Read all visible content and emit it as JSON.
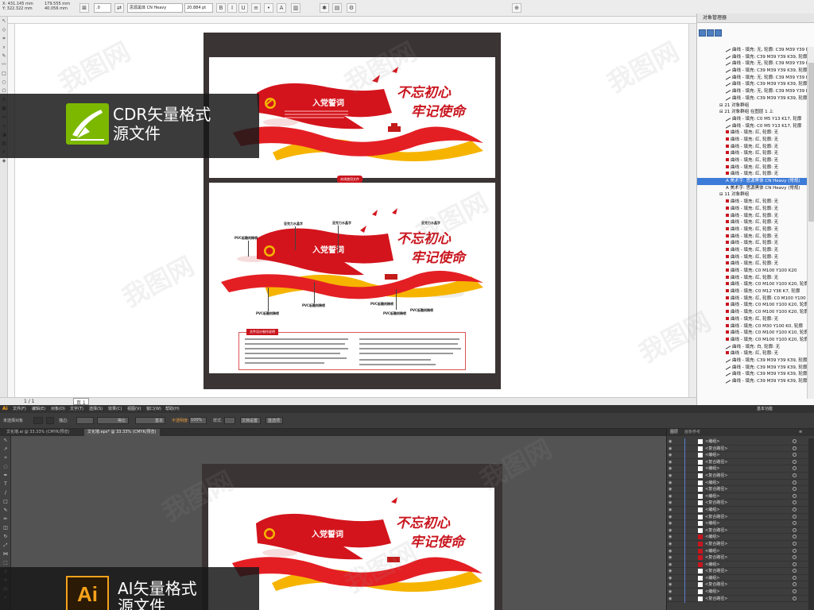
{
  "cdr": {
    "toolbar": {
      "x_label": "X:",
      "x_value": "431.145 mm",
      "y_label": "Y:",
      "y_value": "322.322 mm",
      "w_value": "179.555 mm",
      "h_value": "40.056 mm",
      "angle": ".0",
      "font_name": "思源黑体 CN Heavy",
      "font_size": "20.884 pt"
    },
    "status": {
      "page_indicator": "1 / 1",
      "page_tab": "页 1"
    },
    "separator_label": "本线使用文件",
    "artwork": {
      "flag_title": "入党誓词",
      "calligraphy_1": "不忘初心",
      "calligraphy_2": "牢记使命",
      "callouts": [
        "亚克力水晶字",
        "亚克力水晶字",
        "PVC板雕刻精喷",
        "PVC板雕刻精喷",
        "PVC板雕刻精喷",
        "PVC板雕刻精喷",
        "PVC板雕刻精喷"
      ],
      "notes_title": "文件设计制作说明"
    },
    "overlay_text_line1": "CDR矢量格式",
    "overlay_text_line2": "源文件"
  },
  "object_manager": {
    "title": "对象管理器",
    "rows": [
      {
        "text": "曲线 - 填充: 无, 轮廓: C39 M39 Y39 K39",
        "type": "curve"
      },
      {
        "text": "曲线 - 填充: C39 M39 Y39 K39, 轮廓",
        "type": "curve"
      },
      {
        "text": "曲线 - 填充: 无, 轮廓: C39 M39 Y39 K39",
        "type": "curve"
      },
      {
        "text": "曲线 - 填充: C39 M39 Y39 K39, 轮廓",
        "type": "curve"
      },
      {
        "text": "曲线 - 填充: 无, 轮廓: C39 M39 Y39 K39",
        "type": "curve"
      },
      {
        "text": "曲线 - 填充: C39 M39 Y39 K39, 轮廓",
        "type": "curve"
      },
      {
        "text": "曲线 - 填充: 无, 轮廓: C39 M39 Y39 K39",
        "type": "curve"
      },
      {
        "text": "曲线 - 填充: C39 M39 Y39 K39, 轮廓",
        "type": "curve"
      },
      {
        "text": "21 对象群组",
        "type": "group"
      },
      {
        "text": "21 对象群组 在图层 1 上",
        "type": "group"
      },
      {
        "text": "曲线 - 填充: C0 M5 Y13 K17, 轮廓",
        "type": "curve"
      },
      {
        "text": "曲线 - 填充: C0 M5 Y13 K17, 轮廓",
        "type": "curve"
      },
      {
        "text": "曲线 - 填充: 红, 轮廓: 无",
        "type": "red"
      },
      {
        "text": "曲线 - 填充: 红, 轮廓: 无",
        "type": "red"
      },
      {
        "text": "曲线 - 填充: 红, 轮廓: 无",
        "type": "red"
      },
      {
        "text": "曲线 - 填充: 红, 轮廓: 无",
        "type": "red"
      },
      {
        "text": "曲线 - 填充: 红, 轮廓: 无",
        "type": "red"
      },
      {
        "text": "曲线 - 填充: 红, 轮廓: 无",
        "type": "red"
      },
      {
        "text": "曲线 - 填充: 红, 轮廓: 无",
        "type": "red"
      },
      {
        "text": "美术字: 思源黑体 CN Heavy (常规)",
        "type": "text",
        "selected": true
      },
      {
        "text": "美术字: 思源黑体 CN Heavy (常规)",
        "type": "text"
      },
      {
        "text": "11 对象群组",
        "type": "group"
      },
      {
        "text": "曲线 - 填充: 红, 轮廓: 无",
        "type": "red"
      },
      {
        "text": "曲线 - 填充: 红, 轮廓: 无",
        "type": "red"
      },
      {
        "text": "曲线 - 填充: 红, 轮廓: 无",
        "type": "red"
      },
      {
        "text": "曲线 - 填充: 红, 轮廓: 无",
        "type": "red"
      },
      {
        "text": "曲线 - 填充: 红, 轮廓: 无",
        "type": "red"
      },
      {
        "text": "曲线 - 填充: 红, 轮廓: 无",
        "type": "red"
      },
      {
        "text": "曲线 - 填充: 红, 轮廓: 无",
        "type": "red"
      },
      {
        "text": "曲线 - 填充: 红, 轮廓: 无",
        "type": "red"
      },
      {
        "text": "曲线 - 填充: 红, 轮廓: 无",
        "type": "red"
      },
      {
        "text": "曲线 - 填充: 红, 轮廓: 无",
        "type": "red"
      },
      {
        "text": "曲线 - 填充: C0 M100 Y100 K20",
        "type": "red"
      },
      {
        "text": "曲线 - 填充: 红, 轮廓: 无",
        "type": "red"
      },
      {
        "text": "曲线 - 填充: C0 M100 Y100 K20, 轮廓",
        "type": "red"
      },
      {
        "text": "曲线 - 填充: C0 M12 Y36 K7, 轮廓",
        "type": "red"
      },
      {
        "text": "曲线 - 填充: 红, 轮廓: C0 M100 Y100",
        "type": "red"
      },
      {
        "text": "曲线 - 填充: C0 M100 Y100 K20, 轮廓",
        "type": "red"
      },
      {
        "text": "曲线 - 填充: C0 M100 Y100 K20, 轮廓",
        "type": "red"
      },
      {
        "text": "曲线 - 填充: 红, 轮廓: 无",
        "type": "red"
      },
      {
        "text": "曲线 - 填充: C0 M30 Y100 K0, 轮廓",
        "type": "red"
      },
      {
        "text": "曲线 - 填充: C0 M100 Y100 K10, 轮廓",
        "type": "red"
      },
      {
        "text": "曲线 - 填充: C0 M100 Y100 K20, 轮廓",
        "type": "red"
      },
      {
        "text": "曲线 - 填充: 白, 轮廓: 无",
        "type": "curve"
      },
      {
        "text": "曲线 - 填充: 红, 轮廓: 无",
        "type": "red"
      },
      {
        "text": "曲线 - 填充: C39 M39 Y39 K39, 轮廓",
        "type": "curve"
      },
      {
        "text": "曲线 - 填充: C39 M39 Y39 K39, 轮廓",
        "type": "curve"
      },
      {
        "text": "曲线 - 填充: C39 M39 Y39 K39, 轮廓",
        "type": "curve"
      },
      {
        "text": "曲线 - 填充: C39 M39 Y39 K39, 轮廓",
        "type": "curve"
      }
    ]
  },
  "ai": {
    "app_logo": "Ai",
    "menus": [
      "文件(F)",
      "编辑(E)",
      "对象(O)",
      "文字(T)",
      "选择(S)",
      "效果(C)",
      "视图(V)",
      "窗口(W)",
      "帮助(H)"
    ],
    "workspace": "基本功能",
    "ctrl": {
      "no_selection": "未选择对象",
      "stroke_label": "描边:",
      "stroke_option": "等比",
      "basic_label": "基本",
      "opacity_label": "不透明度:",
      "opacity_value": "100%",
      "style_label": "样式:",
      "doc_setup": "文档设置",
      "prefs": "首选项"
    },
    "tabs": [
      {
        "label": "文化墙.ai @ 33.33% (CMYK/预览)",
        "active": false
      },
      {
        "label": "文化墙.eps* @ 33.33% (CMYK/预览)",
        "active": true
      }
    ],
    "layers_panel": {
      "tab_layers": "图层",
      "tab_artboards": "画板参考"
    },
    "layer_rows": [
      {
        "name": "<编组>",
        "red": false
      },
      {
        "name": "<复合路径>",
        "red": false
      },
      {
        "name": "<编组>",
        "red": false
      },
      {
        "name": "<复合路径>",
        "red": false
      },
      {
        "name": "<编组>",
        "red": false
      },
      {
        "name": "<复合路径>",
        "red": false
      },
      {
        "name": "<编组>",
        "red": false
      },
      {
        "name": "<复合路径>",
        "red": false
      },
      {
        "name": "<编组>",
        "red": false
      },
      {
        "name": "<复合路径>",
        "red": false
      },
      {
        "name": "<编组>",
        "red": false
      },
      {
        "name": "<复合路径>",
        "red": false
      },
      {
        "name": "<编组>",
        "red": false
      },
      {
        "name": "<复合路径>",
        "red": false
      },
      {
        "name": "<编组>",
        "red": true
      },
      {
        "name": "<复合路径>",
        "red": true
      },
      {
        "name": "<编组>",
        "red": true
      },
      {
        "name": "<复合路径>",
        "red": true
      },
      {
        "name": "<编组>",
        "red": true
      },
      {
        "name": "<复合路径>",
        "red": false
      },
      {
        "name": "<编组>",
        "red": false
      },
      {
        "name": "<复合路径>",
        "red": false
      },
      {
        "name": "<编组>",
        "red": false
      },
      {
        "name": "<复合路径>",
        "red": false
      }
    ],
    "artwork": {
      "flag_title": "入党誓词",
      "calligraphy_1": "不忘初心",
      "calligraphy_2": "牢记使命"
    },
    "overlay_text_line1": "AI矢量格式",
    "overlay_text_line2": "源文件"
  },
  "watermark": "我图网"
}
